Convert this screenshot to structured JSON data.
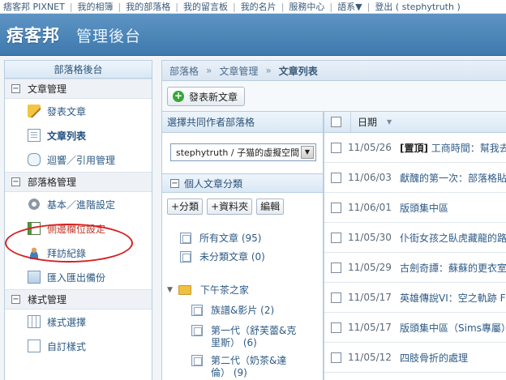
{
  "topbar": {
    "links": [
      "痞客邦 PIXNET",
      "我的相簿",
      "我的部落格",
      "我的留言板",
      "我的名片",
      "服務中心",
      "語系▼",
      "登出 ( stephytruth )"
    ]
  },
  "header": {
    "logo": "痞客邦",
    "title": "管理後台"
  },
  "sidebar": {
    "title": "部落格後台",
    "sections": [
      {
        "label": "文章管理",
        "toggle": "−",
        "items": [
          {
            "label": "發表文章",
            "icon": "pencil-icon"
          },
          {
            "label": "文章列表",
            "icon": "page-icon",
            "active": true
          },
          {
            "label": "迴響／引用管理",
            "icon": "comment-bubble-icon"
          }
        ]
      },
      {
        "label": "部落格管理",
        "toggle": "−",
        "items": [
          {
            "label": "基本／進階設定",
            "icon": "gear-icon"
          },
          {
            "label": "側邊欄位設定",
            "icon": "layout-icon",
            "highlighted": true
          },
          {
            "label": "拜訪紀錄",
            "icon": "person-icon"
          },
          {
            "label": "匯入匯出備份",
            "icon": "database-icon"
          }
        ]
      },
      {
        "label": "樣式管理",
        "toggle": "−",
        "items": [
          {
            "label": "樣式選擇",
            "icon": "grid-icon"
          },
          {
            "label": "自訂樣式",
            "icon": "document-icon"
          }
        ]
      }
    ]
  },
  "breadcrumb": {
    "items": [
      "部落格",
      "文章管理",
      "文章列表"
    ],
    "separator": "»"
  },
  "toolbar": {
    "new_post_label": "發表新文章",
    "new_post_icon": "+"
  },
  "coauthor": {
    "heading": "選擇共同作者部落格",
    "selected": "stephytruth / 子猫的虛擬空間"
  },
  "categories": {
    "heading": "個人文章分類",
    "toggle": "−",
    "buttons": [
      "+分類",
      "+資料夾",
      "編輯"
    ],
    "top_items": [
      "所有文章 (95)",
      "未分類文章 (0)"
    ],
    "folder": "下午茶之家",
    "folder_items": [
      "族譜&影片 (2)",
      "第一代（舒芙蕾&克里斯） (6)",
      "第二代（奶茶&達倫） (9)"
    ]
  },
  "list": {
    "date_header": "日期",
    "rows": [
      {
        "date": "11/05/26",
        "tag": "[置頂]",
        "title": " 工商時間：幫我去投票吧"
      },
      {
        "date": "11/06/03",
        "tag": "",
        "title": "獻醜的第一次：部落格貼圖"
      },
      {
        "date": "11/06/01",
        "tag": "",
        "title": "版頭集中區"
      },
      {
        "date": "11/05/30",
        "tag": "",
        "title": "仆街女孩之臥虎藏龍的路人"
      },
      {
        "date": "11/05/29",
        "tag": "",
        "title": "古劍奇譚：蘇蘇的更衣室"
      },
      {
        "date": "11/05/17",
        "tag": "",
        "title": "英雄傳說VI：空之軌跡 FC"
      },
      {
        "date": "11/05/17",
        "tag": "",
        "title": "版頭集中區（Sims專屬）"
      },
      {
        "date": "11/05/12",
        "tag": "",
        "title": "四肢骨折的處理"
      }
    ]
  },
  "colors": {
    "header_blue": "#4a86bb",
    "link_blue": "#2d5a86",
    "annotation_red": "#d42020",
    "add_green": "#3aa53a"
  }
}
